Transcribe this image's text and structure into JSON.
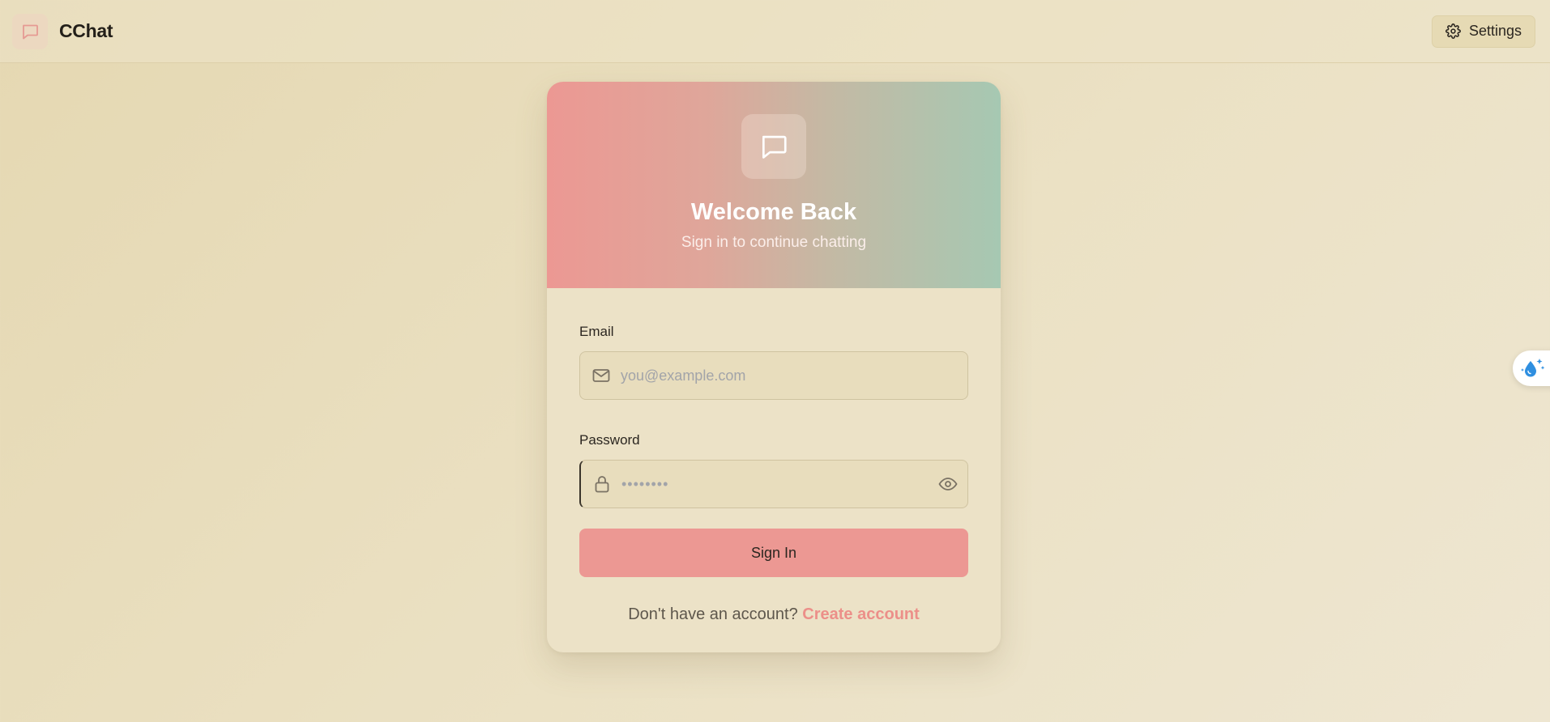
{
  "app": {
    "name": "CChat"
  },
  "header": {
    "settings_label": "Settings"
  },
  "login": {
    "title": "Welcome Back",
    "subtitle": "Sign in to continue chatting",
    "email_label": "Email",
    "email_placeholder": "you@example.com",
    "password_label": "Password",
    "password_placeholder": "••••••••",
    "signin_label": "Sign In",
    "no_account_text": "Don't have an account?",
    "create_account_label": "Create account"
  },
  "colors": {
    "accent": "#ec9893",
    "gradient_start": "#ec9893",
    "gradient_end": "#a6c8b2",
    "link": "#ec8f89",
    "background": "#e8dcb9"
  },
  "icons": {
    "brand": "chat-bubble-icon",
    "settings": "gear-icon",
    "header": "chat-bubble-icon",
    "email": "mail-icon",
    "password": "lock-icon",
    "toggle_password": "eye-icon",
    "widget": "water-drop-sparkle-icon"
  }
}
